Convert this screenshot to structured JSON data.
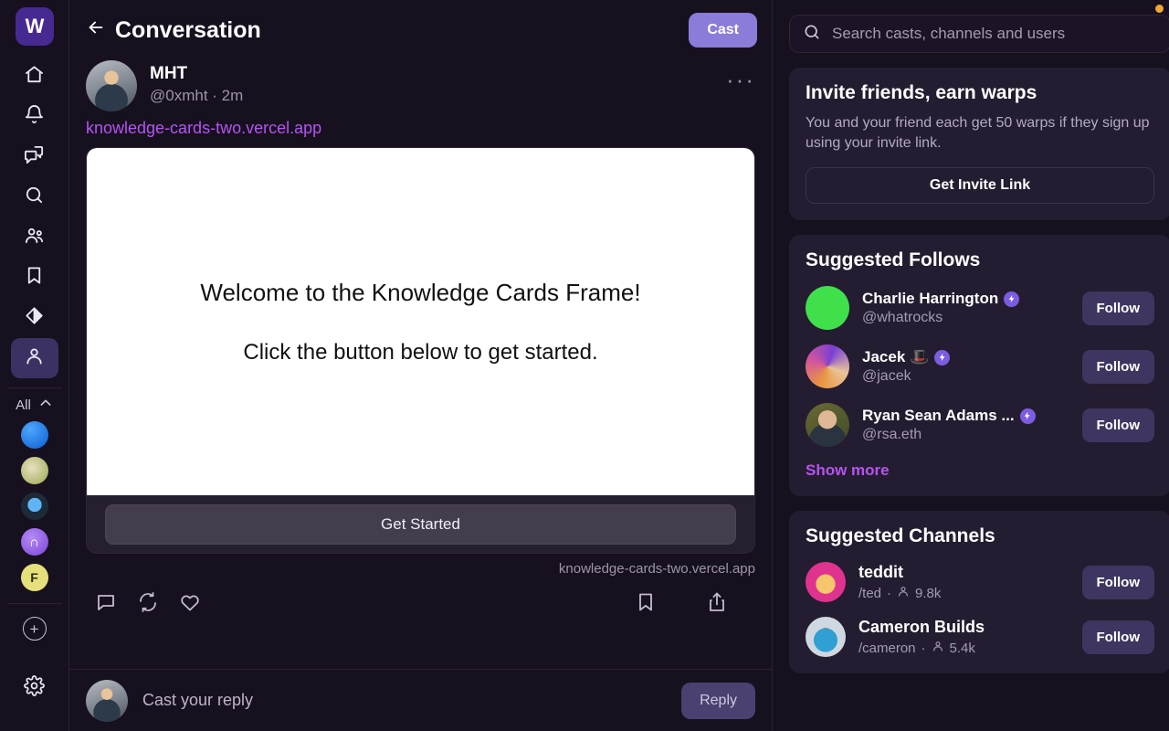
{
  "brand": {
    "logo_text": "W",
    "accent": "#8a7cd8",
    "link": "#b455f0"
  },
  "rail": {
    "nav": [
      {
        "name": "home",
        "icon": "home-icon"
      },
      {
        "name": "notifications",
        "icon": "bell-icon"
      },
      {
        "name": "messages",
        "icon": "chat-icon"
      },
      {
        "name": "search",
        "icon": "search-icon"
      },
      {
        "name": "channels",
        "icon": "users-icon"
      },
      {
        "name": "bookmarks",
        "icon": "bookmark-icon"
      },
      {
        "name": "frames",
        "icon": "diamond-icon"
      },
      {
        "name": "profile",
        "icon": "person-icon",
        "active": true
      }
    ],
    "all_label": "All",
    "channels": [
      {
        "name": "channel-1",
        "color": "#1576e8"
      },
      {
        "name": "channel-2",
        "color": "#b4c15b"
      },
      {
        "name": "channel-3",
        "color": "#2a85e0"
      },
      {
        "name": "channel-4",
        "color": "#9b6fe0"
      },
      {
        "name": "channel-5",
        "color": "#e5e07a",
        "letter": "F"
      }
    ],
    "add_label": "+",
    "settings_icon": "gear-icon"
  },
  "header": {
    "back_icon": "arrow-left-icon",
    "title": "Conversation",
    "cast_label": "Cast"
  },
  "cast": {
    "display_name": "MHT",
    "handle": "@0xmht · 2m",
    "more_icon": "more-horizontal-icon",
    "embed_url": "knowledge-cards-two.vercel.app",
    "frame": {
      "heading": "Welcome to the Knowledge Cards Frame!",
      "paragraph": "Click the button below to get started.",
      "button_label": "Get Started",
      "domain": "knowledge-cards-two.vercel.app"
    },
    "actions": {
      "reply": "reply-icon",
      "recast": "recast-icon",
      "like": "heart-icon",
      "bookmark": "bookmark-icon",
      "share": "share-icon"
    }
  },
  "reply_bar": {
    "placeholder": "Cast your reply",
    "button_label": "Reply"
  },
  "search": {
    "icon": "search-icon",
    "placeholder": "Search casts, channels and users"
  },
  "invite": {
    "title": "Invite friends, earn warps",
    "description": "You and your friend each get 50 warps if they sign up using your invite link.",
    "button_label": "Get Invite Link"
  },
  "suggested_follows": {
    "title": "Suggested Follows",
    "show_more": "Show more",
    "follow_label": "Follow",
    "users": [
      {
        "name": "Charlie Harrington",
        "handle": "@whatrocks",
        "badge": true,
        "avatar_color": "#3fe04a"
      },
      {
        "name": "Jacek 🎩",
        "handle": "@jacek",
        "badge": true,
        "avatar_color": "#d4569b"
      },
      {
        "name": "Ryan Sean Adams ...",
        "handle": "@rsa.eth",
        "badge": true,
        "avatar_color": "#5d5c2a"
      }
    ]
  },
  "suggested_channels": {
    "title": "Suggested Channels",
    "follow_label": "Follow",
    "channels": [
      {
        "name": "teddit",
        "slug": "/ted",
        "members": "9.8k",
        "avatar_color": "#e0338f"
      },
      {
        "name": "Cameron Builds",
        "slug": "/cameron",
        "members": "5.4k",
        "avatar_color": "#b9c7d4"
      }
    ]
  }
}
